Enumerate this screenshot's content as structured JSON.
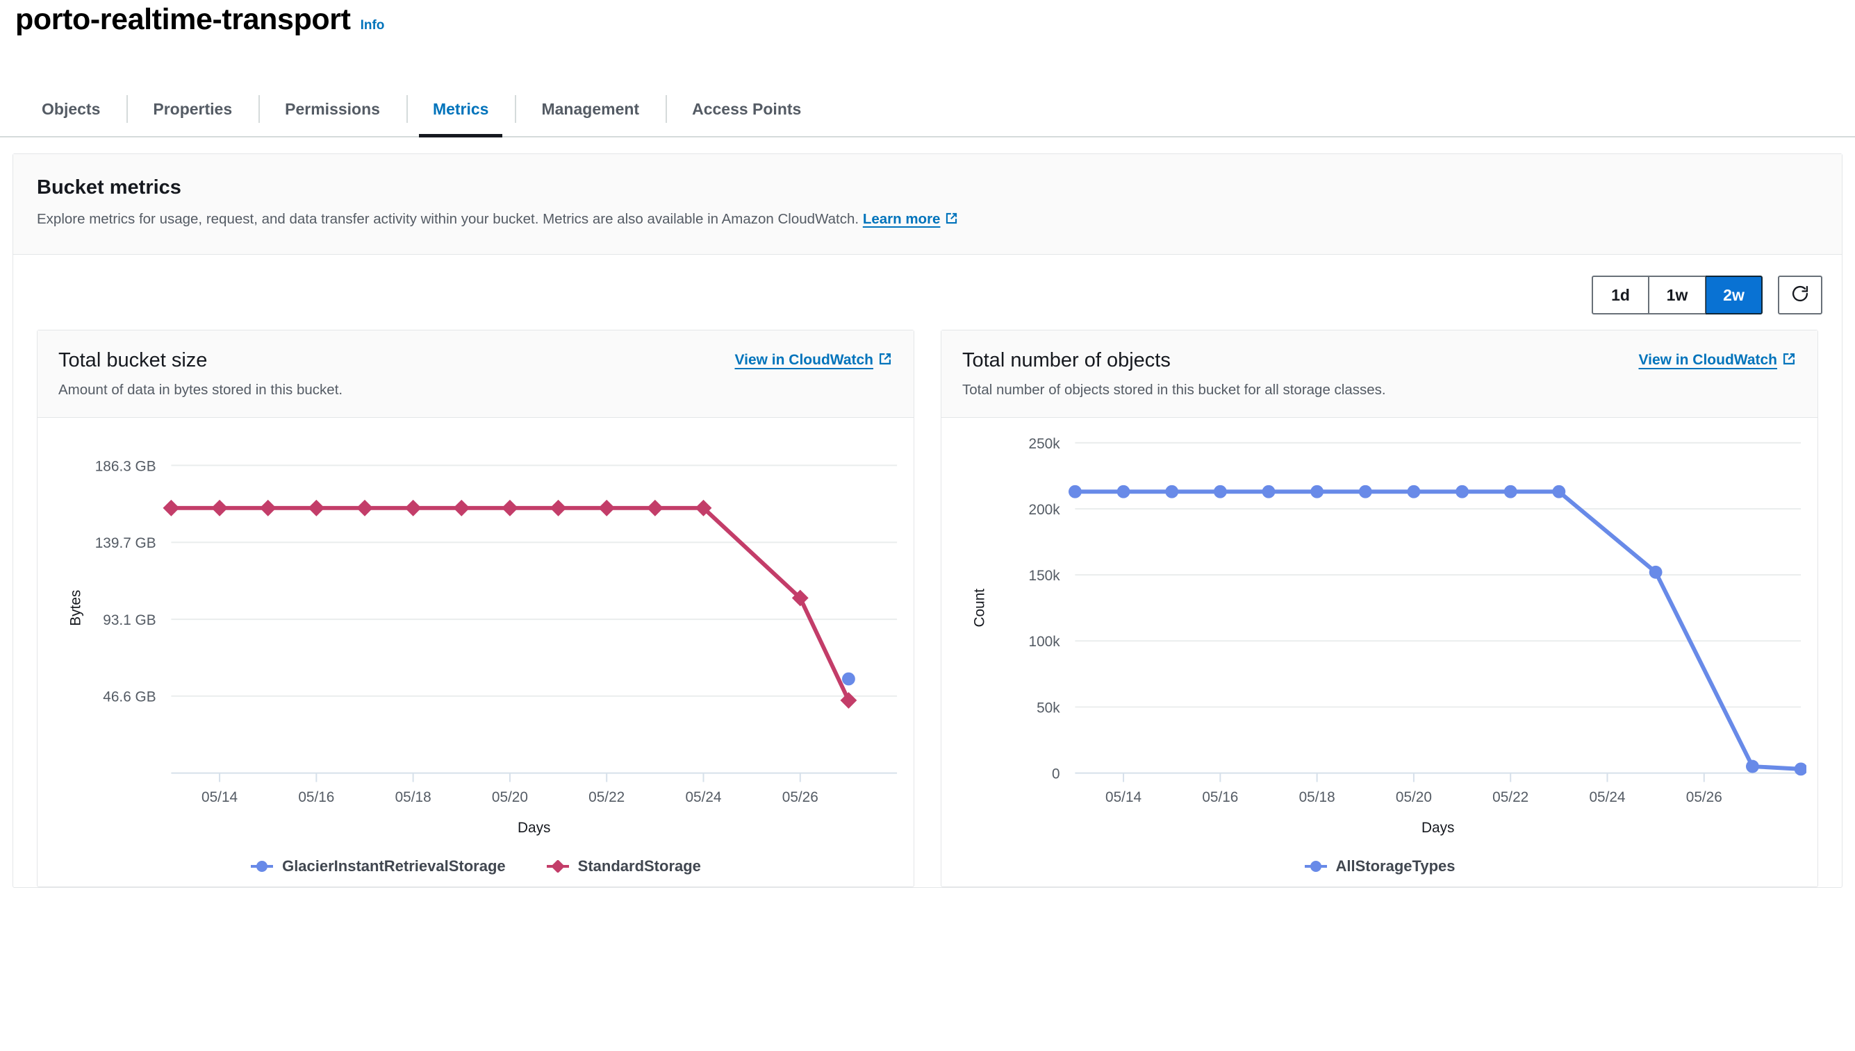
{
  "header": {
    "bucket_name": "porto-realtime-transport",
    "info_label": "Info"
  },
  "tabs": [
    {
      "label": "Objects",
      "active": false
    },
    {
      "label": "Properties",
      "active": false
    },
    {
      "label": "Permissions",
      "active": false
    },
    {
      "label": "Metrics",
      "active": true
    },
    {
      "label": "Management",
      "active": false
    },
    {
      "label": "Access Points",
      "active": false
    }
  ],
  "panel": {
    "title": "Bucket metrics",
    "description_before": "Explore metrics for usage, request, and data transfer activity within your bucket. Metrics are also available in Amazon CloudWatch.",
    "learn_more_label": "Learn more",
    "external_link_icon": "external-link-icon"
  },
  "toolbar": {
    "ranges": [
      {
        "label": "1d",
        "selected": false
      },
      {
        "label": "1w",
        "selected": false
      },
      {
        "label": "2w",
        "selected": true
      }
    ],
    "refresh_icon": "refresh-icon",
    "selected_range": "2w"
  },
  "cards": [
    {
      "title": "Total bucket size",
      "subtitle": "Amount of data in bytes stored in this bucket.",
      "cloudwatch_link": "View in CloudWatch",
      "external_link_icon": "external-link-icon"
    },
    {
      "title": "Total number of objects",
      "subtitle": "Total number of objects stored in this bucket for all storage classes.",
      "cloudwatch_link": "View in CloudWatch",
      "external_link_icon": "external-link-icon"
    }
  ],
  "colors": {
    "accent_blue": "#0073bb",
    "selected_button": "#0972d3",
    "series_blue": "#688ae8",
    "series_crimson": "#c33d69",
    "grid": "#eaeded",
    "text_muted": "#545b64"
  },
  "chart_data": [
    {
      "type": "line",
      "title": "Total bucket size",
      "xlabel": "Days",
      "ylabel": "Bytes",
      "x": [
        "05/13",
        "05/14",
        "05/15",
        "05/16",
        "05/17",
        "05/18",
        "05/19",
        "05/20",
        "05/21",
        "05/22",
        "05/23",
        "05/24",
        "05/25",
        "05/26",
        "05/27",
        "05/28"
      ],
      "xtick_labels": [
        "05/14",
        "05/16",
        "05/18",
        "05/20",
        "05/22",
        "05/24",
        "05/26"
      ],
      "ytick_labels": [
        "186.3 GB",
        "139.7 GB",
        "93.1 GB",
        "46.6 GB"
      ],
      "ytick_values": [
        186.3,
        139.7,
        93.1,
        46.6
      ],
      "ylim": [
        0,
        200
      ],
      "yunit": "GB",
      "grid": true,
      "legend_position": "bottom",
      "series": [
        {
          "name": "GlacierInstantRetrievalStorage",
          "color": "#688ae8",
          "marker": "circle",
          "points": [
            {
              "x": "05/27",
              "y": 57.0
            }
          ]
        },
        {
          "name": "StandardStorage",
          "color": "#c33d69",
          "marker": "diamond",
          "points": [
            {
              "x": "05/13",
              "y": 160.5
            },
            {
              "x": "05/14",
              "y": 160.5
            },
            {
              "x": "05/15",
              "y": 160.5
            },
            {
              "x": "05/16",
              "y": 160.5
            },
            {
              "x": "05/17",
              "y": 160.5
            },
            {
              "x": "05/18",
              "y": 160.5
            },
            {
              "x": "05/19",
              "y": 160.5
            },
            {
              "x": "05/20",
              "y": 160.5
            },
            {
              "x": "05/21",
              "y": 160.5
            },
            {
              "x": "05/22",
              "y": 160.5
            },
            {
              "x": "05/23",
              "y": 160.5
            },
            {
              "x": "05/24",
              "y": 160.5
            },
            {
              "x": "05/26",
              "y": 106.0
            },
            {
              "x": "05/27",
              "y": 44.0
            }
          ]
        }
      ]
    },
    {
      "type": "line",
      "title": "Total number of objects",
      "xlabel": "Days",
      "ylabel": "Count",
      "x": [
        "05/13",
        "05/14",
        "05/15",
        "05/16",
        "05/17",
        "05/18",
        "05/19",
        "05/20",
        "05/21",
        "05/22",
        "05/23",
        "05/24",
        "05/25",
        "05/26",
        "05/27",
        "05/28"
      ],
      "xtick_labels": [
        "05/14",
        "05/16",
        "05/18",
        "05/20",
        "05/22",
        "05/24",
        "05/26"
      ],
      "ytick_labels": [
        "250k",
        "200k",
        "150k",
        "100k",
        "50k",
        "0"
      ],
      "ytick_values": [
        250000,
        200000,
        150000,
        100000,
        50000,
        0
      ],
      "ylim": [
        0,
        250000
      ],
      "grid": true,
      "legend_position": "bottom",
      "series": [
        {
          "name": "AllStorageTypes",
          "color": "#688ae8",
          "marker": "circle",
          "points": [
            {
              "x": "05/13",
              "y": 213000
            },
            {
              "x": "05/14",
              "y": 213000
            },
            {
              "x": "05/15",
              "y": 213000
            },
            {
              "x": "05/16",
              "y": 213000
            },
            {
              "x": "05/17",
              "y": 213000
            },
            {
              "x": "05/18",
              "y": 213000
            },
            {
              "x": "05/19",
              "y": 213000
            },
            {
              "x": "05/20",
              "y": 213000
            },
            {
              "x": "05/21",
              "y": 213000
            },
            {
              "x": "05/22",
              "y": 213000
            },
            {
              "x": "05/23",
              "y": 213000
            },
            {
              "x": "05/25",
              "y": 152000
            },
            {
              "x": "05/27",
              "y": 5000
            },
            {
              "x": "05/28",
              "y": 3000
            }
          ]
        }
      ]
    }
  ]
}
